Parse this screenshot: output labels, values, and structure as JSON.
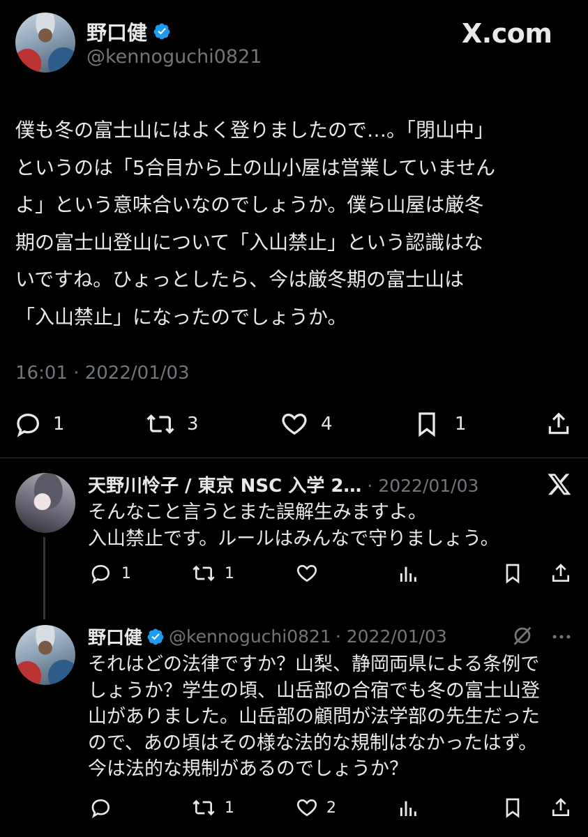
{
  "brand": {
    "label": "X.com"
  },
  "main_post": {
    "display_name": "野口健",
    "handle": "@kennoguchi0821",
    "text": "僕も冬の富士山にはよく登りましたので…。「閉山中」\nというのは「5合目から上の山小屋は営業していません\nよ」という意味合いなのでしょうか。僕ら山屋は厳冬\n期の富士山登山について「入山禁止」という認識はな\nいですね。ひょっとしたら、今は厳冬期の富士山は\n「入山禁止」になったのでしょうか。",
    "timestamp": "16:01 · 2022/01/03",
    "replies": "1",
    "reposts": "3",
    "likes": "4",
    "bookmarks": "1"
  },
  "reply_1": {
    "display_name": "天野川怜子 / 東京 NSC 入学 2…",
    "date": "· 2022/01/03",
    "text": "そんなこと言うとまた誤解生みますよ。\n入山禁止です。ルールはみんなで守りましょう。",
    "replies": "1",
    "reposts": "1"
  },
  "reply_2": {
    "display_name": "野口健",
    "handle": "@kennoguchi0821",
    "date": "· 2022/01/03",
    "text": "それはどの法律ですか？山梨、静岡両県による条例で\nしょうか？学生の頃、山岳部の合宿でも冬の富士山登\n山がありました。山岳部の顧問が法学部の先生だった\nので、あの頃はその様な法的な規制はなかったはず。\n今は法的な規制があるのでしょうか？",
    "reposts": "1",
    "likes": "2"
  },
  "colors": {
    "background": "#000000",
    "text": "#e7e9ea",
    "muted": "#71767b",
    "verified": "#1d9bf0"
  }
}
